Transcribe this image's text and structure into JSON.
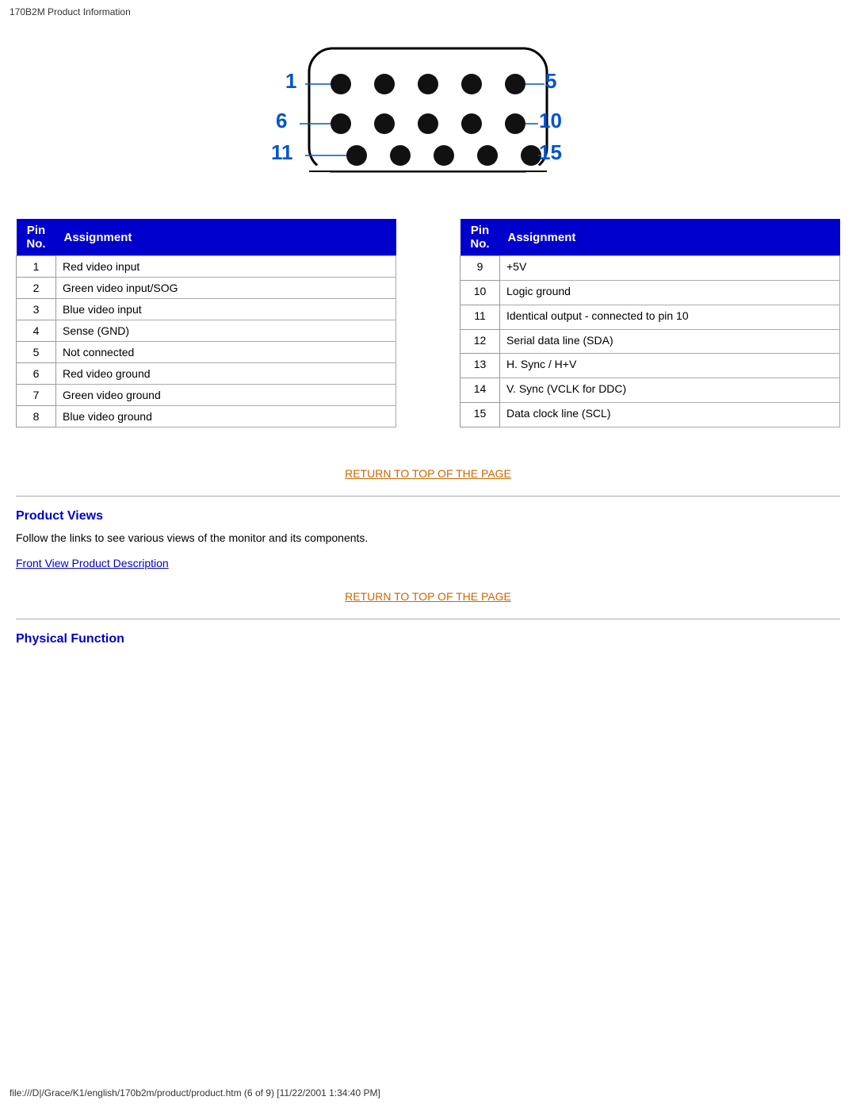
{
  "page": {
    "title": "170B2M Product Information",
    "status_bar": "file:///D|/Grace/K1/english/170b2m/product/product.htm (6 of 9) [11/22/2001 1:34:40 PM]"
  },
  "connector": {
    "pin_labels": [
      "1",
      "5",
      "6",
      "10",
      "11",
      "15"
    ]
  },
  "table_left": {
    "col1_header": "Pin\nNo.",
    "col2_header": "Assignment",
    "rows": [
      {
        "pin": "1",
        "assignment": "Red video input"
      },
      {
        "pin": "2",
        "assignment": "Green video input/SOG"
      },
      {
        "pin": "3",
        "assignment": "Blue video input"
      },
      {
        "pin": "4",
        "assignment": "Sense (GND)"
      },
      {
        "pin": "5",
        "assignment": "Not connected"
      },
      {
        "pin": "6",
        "assignment": "Red video ground"
      },
      {
        "pin": "7",
        "assignment": "Green video ground"
      },
      {
        "pin": "8",
        "assignment": "Blue video ground"
      }
    ]
  },
  "table_right": {
    "col1_header": "Pin\nNo.",
    "col2_header": "Assignment",
    "rows": [
      {
        "pin": "9",
        "assignment": "+5V"
      },
      {
        "pin": "10",
        "assignment": "Logic ground"
      },
      {
        "pin": "11",
        "assignment": "Identical output - connected to pin 10"
      },
      {
        "pin": "12",
        "assignment": "Serial data line (SDA)"
      },
      {
        "pin": "13",
        "assignment": "H. Sync / H+V"
      },
      {
        "pin": "14",
        "assignment": "V. Sync (VCLK for DDC)"
      },
      {
        "pin": "15",
        "assignment": "Data clock line (SCL)"
      }
    ]
  },
  "return_link": "RETURN TO TOP OF THE PAGE",
  "product_views": {
    "heading": "Product Views",
    "body": "Follow the links to see various views of the monitor and its components.",
    "front_view_link": "Front View Product Description"
  },
  "physical_function": {
    "heading": "Physical Function"
  }
}
